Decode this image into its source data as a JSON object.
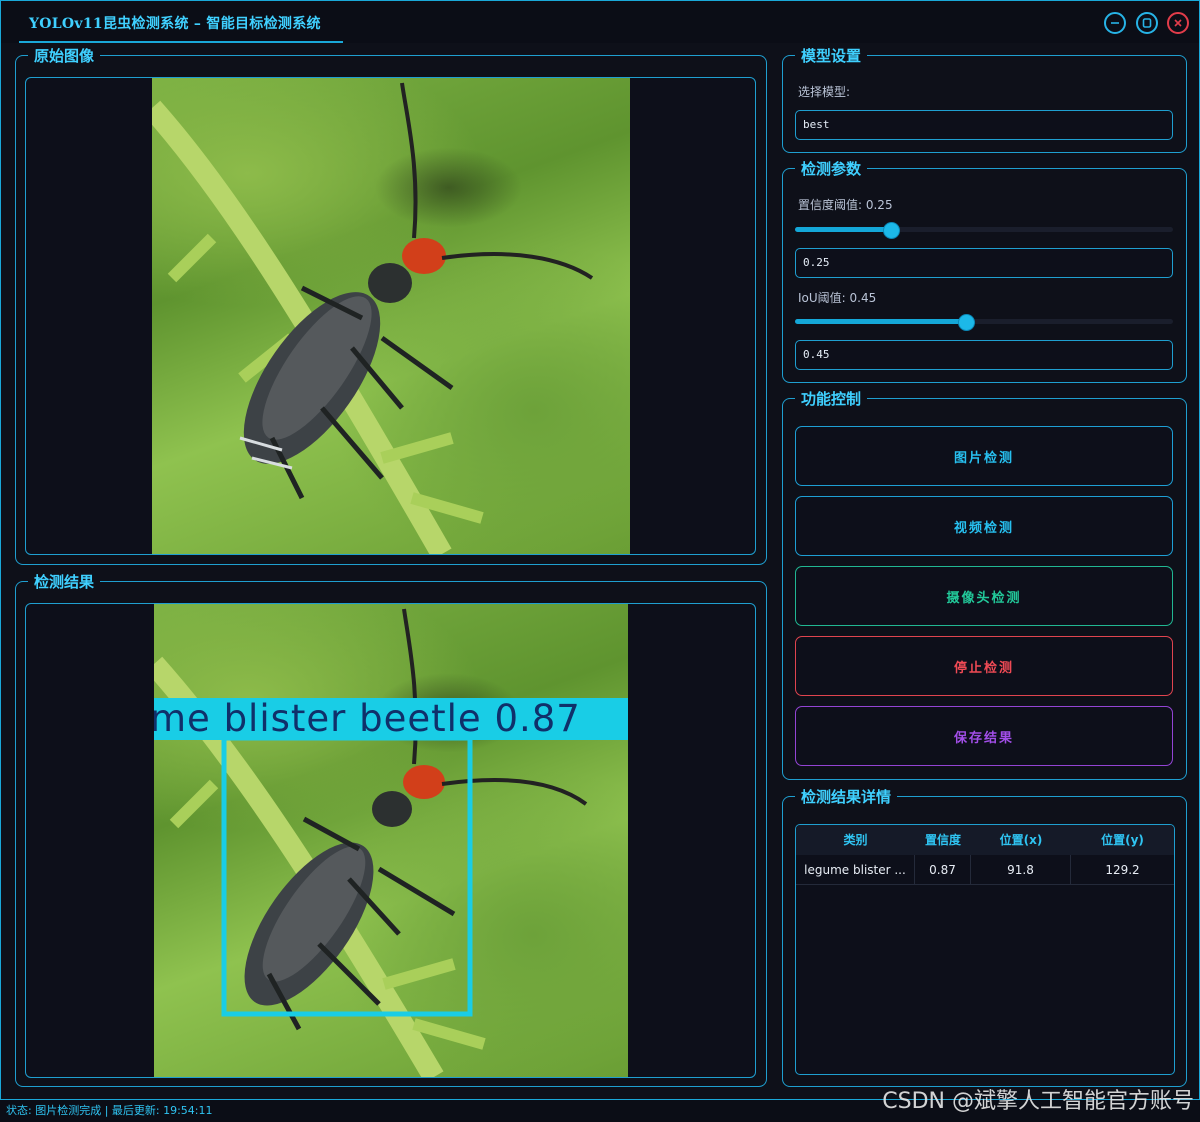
{
  "window": {
    "title": "YOLOv11昆虫检测系统 – 智能目标检测系统"
  },
  "panels": {
    "original": {
      "label": "原始图像"
    },
    "result": {
      "label": "检测结果"
    },
    "detection_overlay": {
      "label": "me blister beetle 0.87"
    }
  },
  "model": {
    "group_label": "模型设置",
    "select_label": "选择模型:",
    "selected": "best"
  },
  "params": {
    "group_label": "检测参数",
    "confidence_label": "置信度阈值: 0.25",
    "confidence_value": "0.25",
    "confidence_fraction": 0.25,
    "iou_label": "IoU阈值: 0.45",
    "iou_value": "0.45",
    "iou_fraction": 0.45
  },
  "controls": {
    "group_label": "功能控制",
    "image_detect": "图片检测",
    "video_detect": "视频检测",
    "camera_detect": "摄像头检测",
    "stop_detect": "停止检测",
    "save_result": "保存结果"
  },
  "details": {
    "group_label": "检测结果详情",
    "columns": [
      "类别",
      "置信度",
      "位置(x)",
      "位置(y)"
    ],
    "rows": [
      [
        "legume blister ...",
        "0.87",
        "91.8",
        "129.2"
      ]
    ]
  },
  "status": {
    "text": "状态: 图片检测完成 | 最后更新: 19:54:11"
  },
  "watermark": "CSDN @斌擎人工智能官方账号",
  "colors": {
    "accent": "#1ec8f0",
    "stop": "#f04a55",
    "camera": "#22c99a",
    "save": "#a24ee8"
  }
}
